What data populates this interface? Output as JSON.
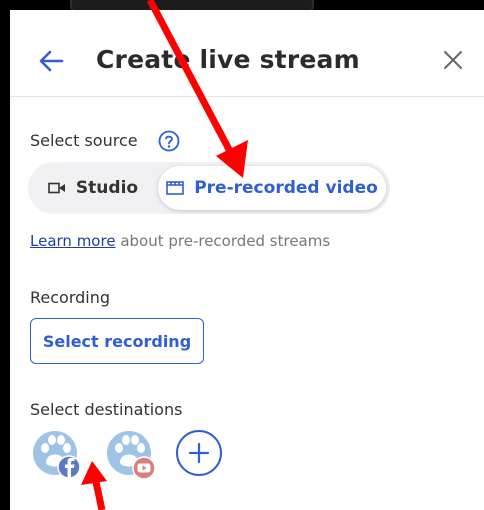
{
  "header": {
    "title": "Create live stream"
  },
  "source": {
    "label": "Select source",
    "options": [
      {
        "label": "Studio",
        "icon": "video-camera-icon",
        "selected": false
      },
      {
        "label": "Pre-recorded video",
        "icon": "film-icon",
        "selected": true
      }
    ]
  },
  "learn": {
    "link": "Learn more",
    "text": " about pre-recorded streams"
  },
  "recording": {
    "label": "Recording",
    "button": "Select recording"
  },
  "destinations": {
    "label": "Select destinations",
    "items": [
      {
        "platform": "facebook",
        "badge_icon": "facebook-icon"
      },
      {
        "platform": "youtube",
        "badge_icon": "youtube-icon"
      }
    ],
    "add_icon": "plus-icon"
  },
  "colors": {
    "accent": "#2f5fd0",
    "annotation": "#ff0000"
  }
}
